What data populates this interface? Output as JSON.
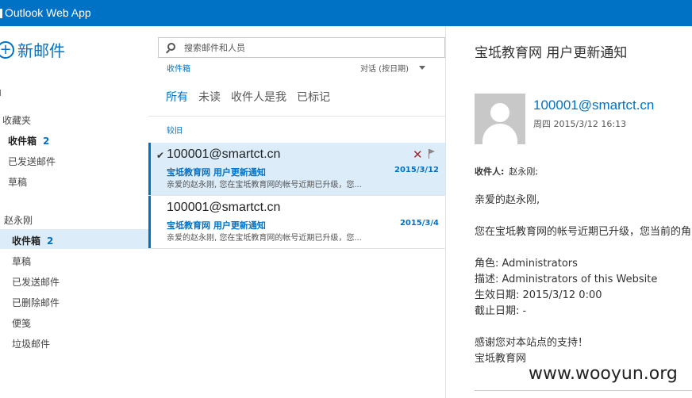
{
  "app": {
    "title": "Outlook Web App"
  },
  "nav": {
    "new_mail": "新邮件",
    "favorites_header": "收藏夹",
    "favorites": [
      {
        "label": "收件箱",
        "count": "2"
      },
      {
        "label": "已发送邮件"
      },
      {
        "label": "草稿"
      }
    ],
    "account_header": "赵永刚",
    "folders": [
      {
        "label": "收件箱",
        "count": "2"
      },
      {
        "label": "草稿"
      },
      {
        "label": "已发送邮件"
      },
      {
        "label": "已删除邮件"
      },
      {
        "label": "便笺"
      },
      {
        "label": "垃圾邮件"
      }
    ]
  },
  "list": {
    "search_placeholder": "搜索邮件和人员",
    "folder_name": "收件箱",
    "sort_label": "对话 (按日期)",
    "filters": [
      "所有",
      "未读",
      "收件人是我",
      "已标记"
    ],
    "group_label": "较旧",
    "messages": [
      {
        "sender": "100001@smartct.cn",
        "subject": "宝坻教育网 用户更新通知",
        "date": "2015/3/12",
        "preview": "亲爱的赵永刚, 您在宝坻教育网的帐号近期已升级，您..."
      },
      {
        "sender": "100001@smartct.cn",
        "subject": "宝坻教育网 用户更新通知",
        "date": "2015/3/4",
        "preview": "亲爱的赵永刚, 您在宝坻教育网的帐号近期已升级，您..."
      }
    ]
  },
  "reading": {
    "title": "宝坻教育网 用户更新通知",
    "from": "100001@smartct.cn",
    "time": "周四 2015/3/12 16:13",
    "to_label": "收件人:",
    "to_value": "赵永刚;",
    "greeting": "亲爱的赵永刚,",
    "body1": "您在宝坻教育网的帐号近期已升级，您当前的角",
    "role": "角色: Administrators",
    "desc": "描述: Administrators of this Website",
    "effective": "生效日期: 2015/3/12 0:00",
    "expiry": "截止日期: -",
    "thanks": "感谢您对本站点的支持！",
    "signature": "宝坻教育网"
  },
  "watermark": "www.wooyun.org",
  "colors": {
    "brand": "#0072c6",
    "selected": "#dcecf9",
    "delete": "#a4262c"
  }
}
